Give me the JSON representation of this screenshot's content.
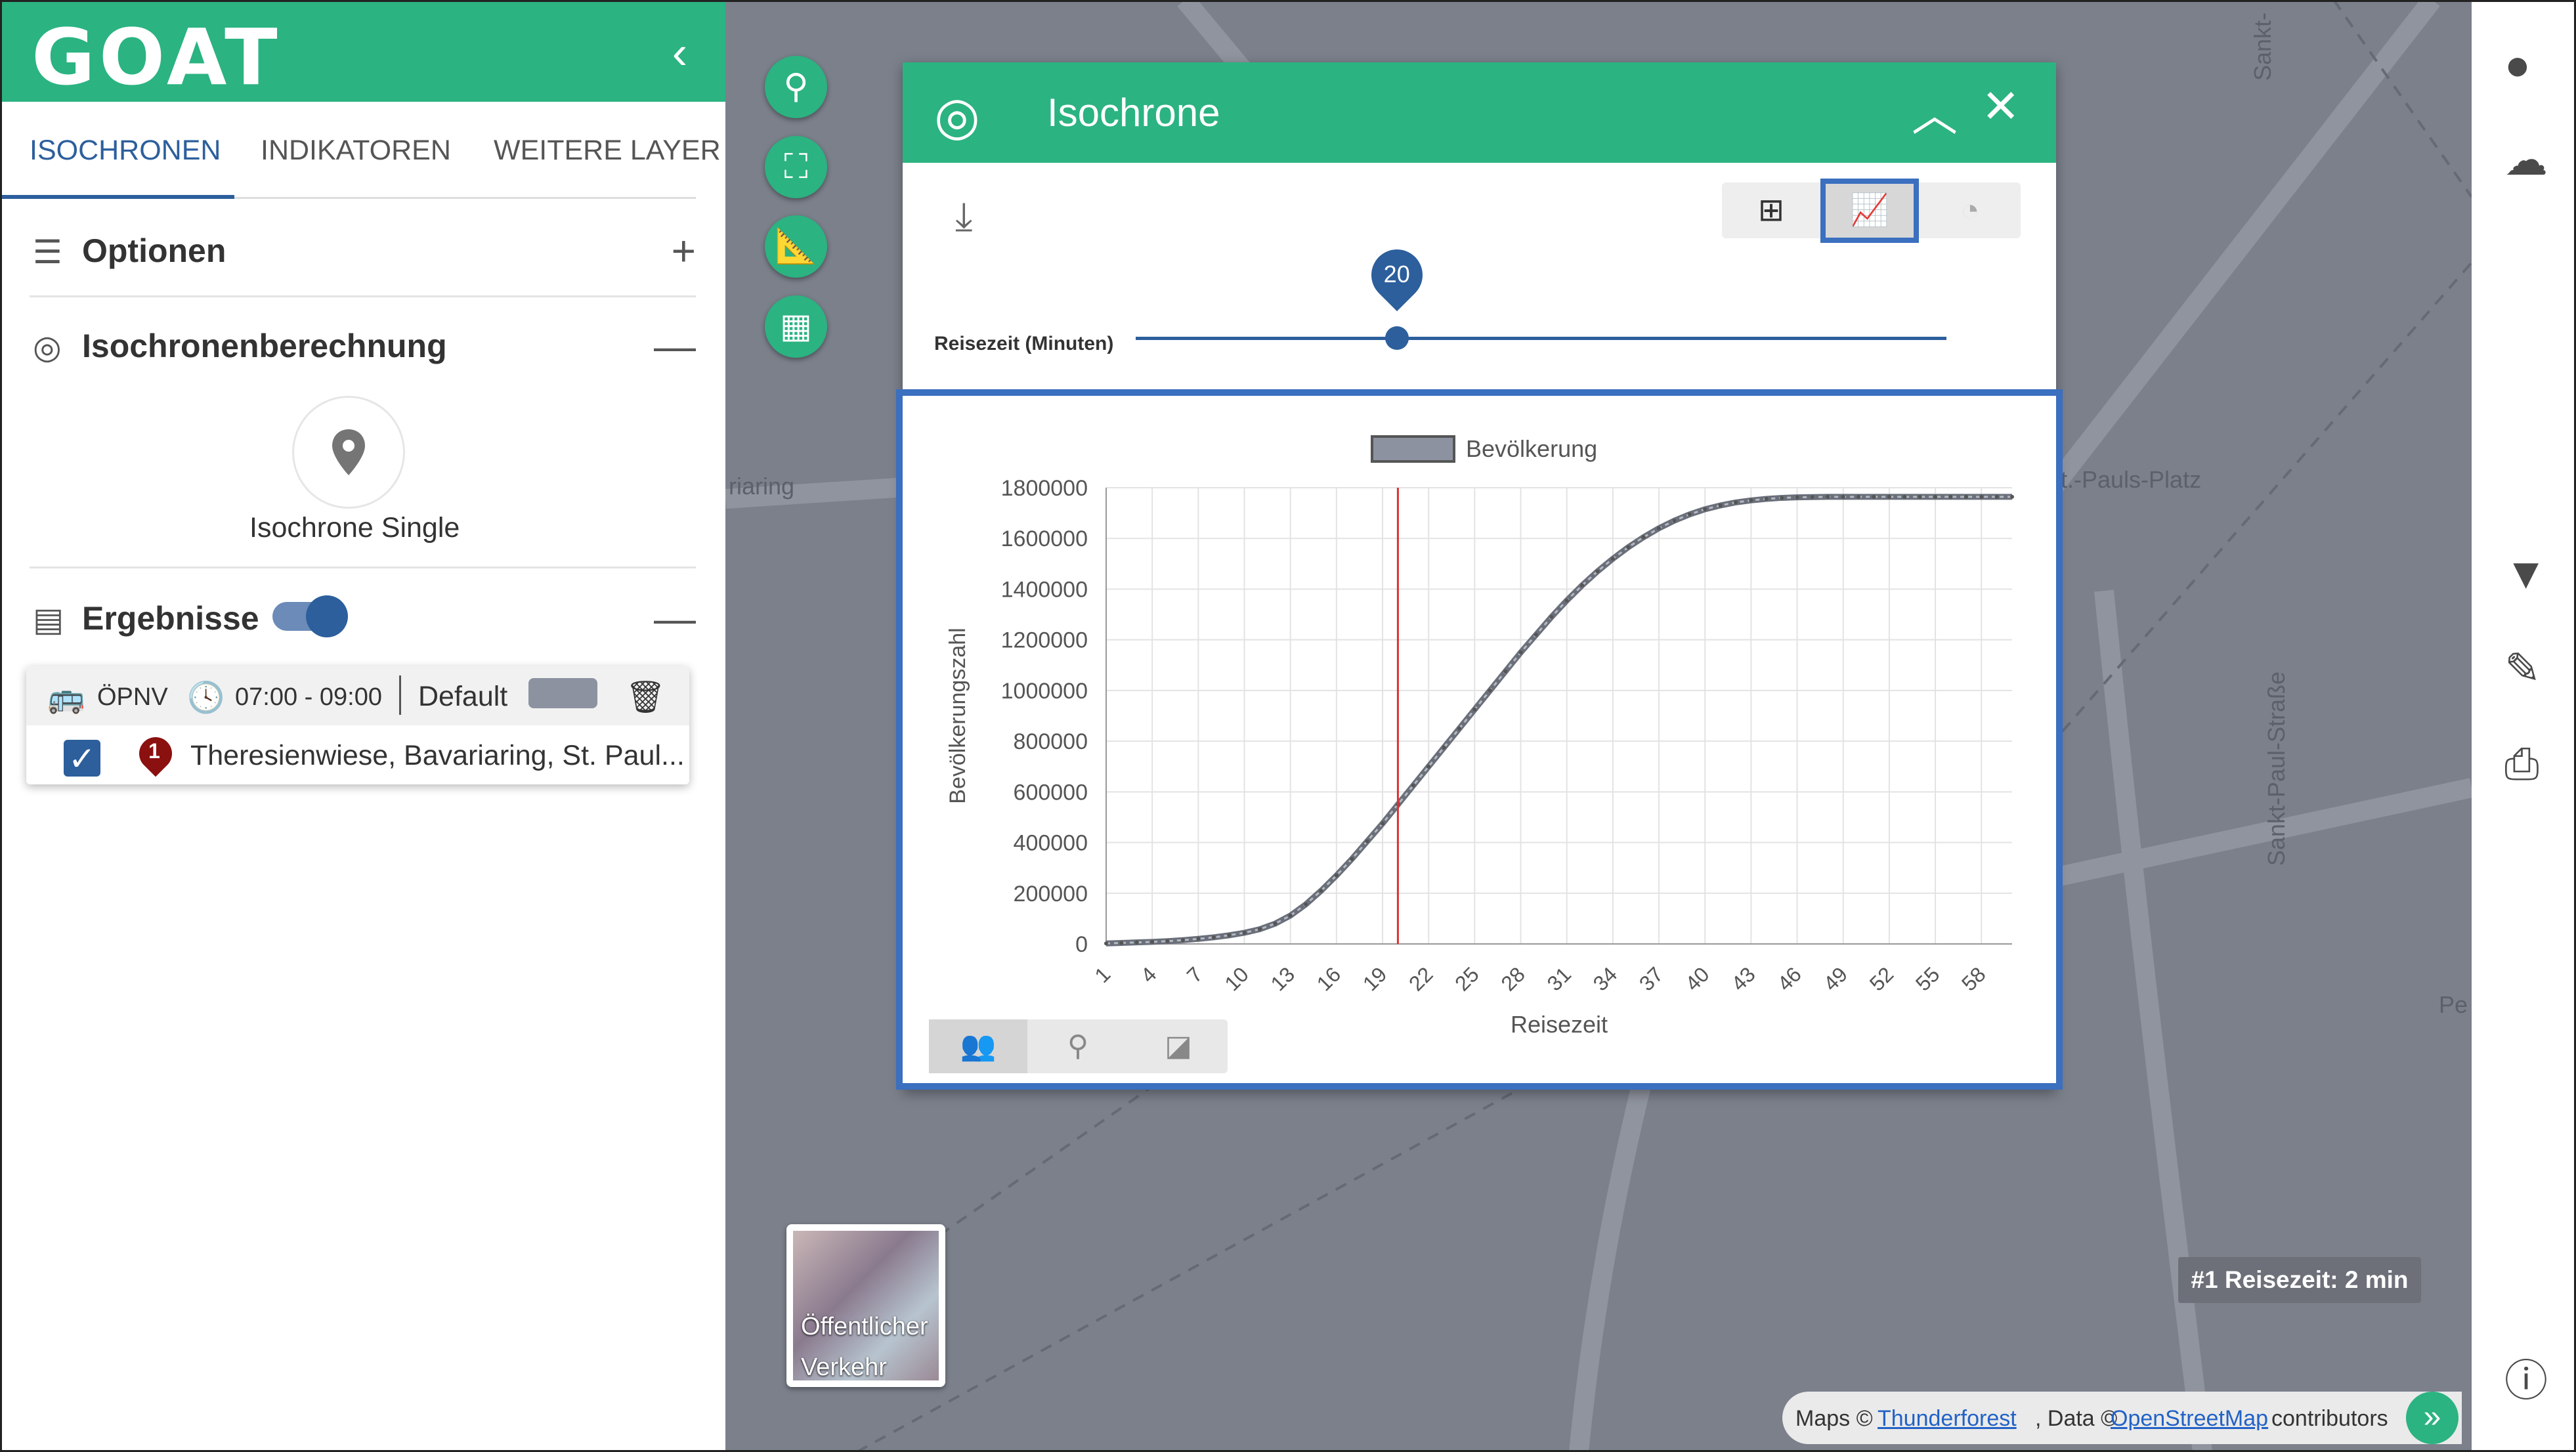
{
  "app": {
    "logo": "GOAT"
  },
  "tabs": [
    {
      "label": "ISOCHRONEN"
    },
    {
      "label": "INDIKATOREN"
    },
    {
      "label": "WEITERE LAYER"
    }
  ],
  "sections": {
    "options": {
      "title": "Optionen",
      "action": "+"
    },
    "calc": {
      "title": "Isochronenberechnung",
      "action": "—"
    },
    "results": {
      "title": "Ergebnisse",
      "action": "—"
    }
  },
  "calc_mode": {
    "label": "Isochrone Single"
  },
  "result": {
    "mode": "ÖPNV",
    "time": "07:00 - 09:00",
    "profile": "Default",
    "marker_number": "1",
    "place": "Theresienwiese, Bavariaring, St. Paul..."
  },
  "dialog": {
    "title": "Isochrone",
    "slider_label": "Reisezeit (Minuten)",
    "slider_value": "20",
    "slider_min": 1,
    "slider_max": 60
  },
  "map": {
    "street_1": "riaring",
    "street_2": "Sankt-Paul-Straße",
    "street_3": "Sankt-",
    "place_label": "St.-Pauls-Platz",
    "street_4": "Pe",
    "basemap_label_1": "Öffentlicher",
    "basemap_label_2": "Verkehr",
    "time_badge": "#1 Reisezeit: 2 min"
  },
  "attribution": {
    "maps_prefix": "Maps ©",
    "maps_link": "Thunderforest",
    "data_prefix": ", Data ©",
    "data_link": "OpenStreetMap",
    "suffix": "contributors"
  },
  "colors": {
    "brand": "#2bb381",
    "primary": "#2c5f9c",
    "series": "#8c92a0",
    "marker_line": "#e03030"
  },
  "chart_data": {
    "type": "line",
    "legend": [
      "Bevölkerung"
    ],
    "xlabel": "Reisezeit",
    "ylabel": "Bevölkerungszahl",
    "marker_x": 20,
    "ylim": [
      0,
      1800000
    ],
    "yticks": [
      0,
      200000,
      400000,
      600000,
      800000,
      1000000,
      1200000,
      1400000,
      1600000,
      1800000
    ],
    "xticks": [
      1,
      4,
      7,
      10,
      13,
      16,
      19,
      22,
      25,
      28,
      31,
      34,
      37,
      40,
      43,
      46,
      49,
      52,
      55,
      58
    ],
    "series": [
      {
        "name": "Bevölkerung",
        "x": [
          1,
          2,
          3,
          4,
          5,
          6,
          7,
          8,
          9,
          10,
          11,
          12,
          13,
          14,
          15,
          16,
          17,
          18,
          19,
          20,
          21,
          22,
          23,
          24,
          25,
          26,
          27,
          28,
          29,
          30,
          31,
          32,
          33,
          34,
          35,
          36,
          37,
          38,
          39,
          40,
          41,
          42,
          43,
          44,
          45,
          46,
          47,
          48,
          49,
          50,
          51,
          52,
          53,
          54,
          55,
          56,
          57,
          58,
          59,
          60
        ],
        "values": [
          2000,
          4000,
          6000,
          8000,
          11000,
          15000,
          20000,
          26000,
          34000,
          44000,
          58000,
          80000,
          112000,
          156000,
          210000,
          270000,
          335000,
          405000,
          475000,
          550000,
          625000,
          700000,
          775000,
          850000,
          925000,
          1000000,
          1075000,
          1150000,
          1220000,
          1290000,
          1355000,
          1415000,
          1470000,
          1520000,
          1565000,
          1605000,
          1640000,
          1670000,
          1695000,
          1715000,
          1730000,
          1742000,
          1750000,
          1756000,
          1760000,
          1762000,
          1763000,
          1764000,
          1764000,
          1764000,
          1764000,
          1764000,
          1764000,
          1764000,
          1764000,
          1764000,
          1764000,
          1764000,
          1764000,
          1764000
        ]
      }
    ]
  }
}
